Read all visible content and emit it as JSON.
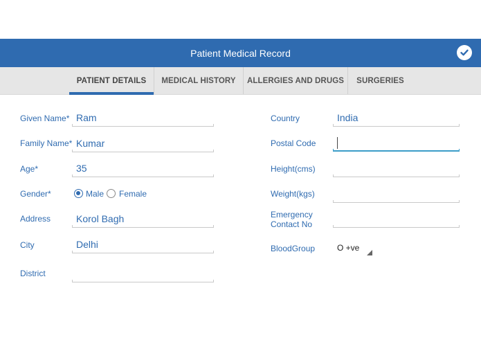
{
  "header": {
    "title": "Patient Medical Record"
  },
  "tabs": [
    {
      "label": "PATIENT DETAILS"
    },
    {
      "label": "MEDICAL HISTORY"
    },
    {
      "label": "ALLERGIES AND DRUGS"
    },
    {
      "label": "SURGERIES"
    }
  ],
  "left": {
    "given_name": {
      "label": "Given Name*",
      "value": "Ram"
    },
    "family_name": {
      "label": "Family Name*",
      "value": "Kumar"
    },
    "age": {
      "label": "Age*",
      "value": "35"
    },
    "gender": {
      "label": "Gender*",
      "options": [
        "Male",
        "Female"
      ],
      "selected": "Male"
    },
    "address": {
      "label": "Address",
      "value": "Korol Bagh"
    },
    "city": {
      "label": "City",
      "value": "Delhi"
    },
    "district": {
      "label": "District",
      "value": ""
    }
  },
  "right": {
    "country": {
      "label": "Country",
      "value": "India"
    },
    "postal_code": {
      "label": "Postal Code",
      "value": ""
    },
    "height": {
      "label": "Height(cms)",
      "value": ""
    },
    "weight": {
      "label": "Weight(kgs)",
      "value": ""
    },
    "emergency": {
      "label_line1": "Emergency",
      "label_line2": "Contact No",
      "value": ""
    },
    "blood_group": {
      "label": "BloodGroup",
      "value": "O +ve"
    }
  },
  "colors": {
    "primary": "#2f6bb0",
    "focus": "#3a9cc8",
    "tabbar": "#e6e6e6"
  }
}
